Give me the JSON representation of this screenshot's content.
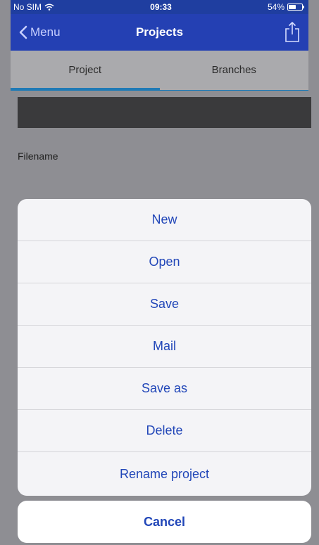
{
  "status_bar": {
    "carrier": "No SIM",
    "time": "09:33",
    "battery": "54%",
    "battery_level": 0.54
  },
  "nav": {
    "back_label": "Menu",
    "title": "Projects",
    "share_icon": "share-icon"
  },
  "tabs": [
    {
      "label": "Project",
      "selected": true
    },
    {
      "label": "Branches",
      "selected": false
    }
  ],
  "form": {
    "filename_label": "Filename"
  },
  "action_sheet": {
    "items": [
      {
        "label": "New"
      },
      {
        "label": "Open"
      },
      {
        "label": "Save"
      },
      {
        "label": "Mail"
      },
      {
        "label": "Save as"
      },
      {
        "label": "Delete"
      },
      {
        "label": "Rename project"
      }
    ],
    "cancel_label": "Cancel"
  },
  "colors": {
    "nav_bg": "#2440b3",
    "accent": "#2146b8",
    "tab_indicator": "#1f7ab5"
  }
}
